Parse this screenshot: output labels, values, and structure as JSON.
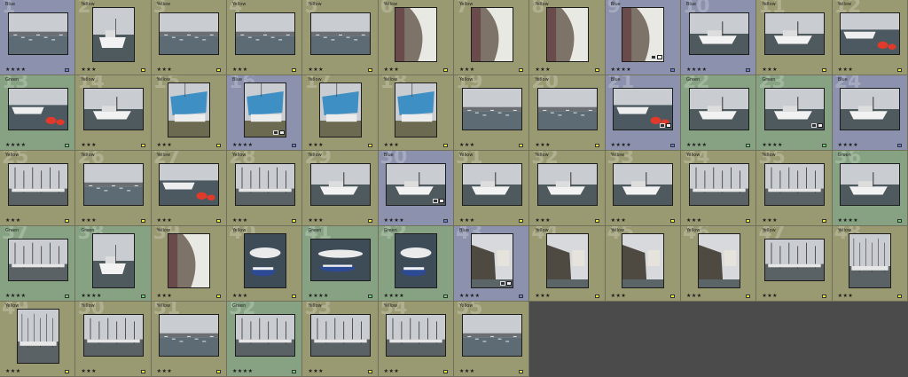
{
  "cells": [
    {
      "number": "1",
      "label": "Blue",
      "color": "Blue",
      "rating": "★★★★",
      "theme": "harbour"
    },
    {
      "number": "2",
      "label": "Yellow",
      "color": "Yellow",
      "rating": "★★★",
      "theme": "boats"
    },
    {
      "number": "3",
      "label": "Yellow",
      "color": "Yellow",
      "rating": "★★★",
      "theme": "harbour"
    },
    {
      "number": "4",
      "label": "Yellow",
      "color": "Yellow",
      "rating": "★★★",
      "theme": "harbour"
    },
    {
      "number": "5",
      "label": "Yellow",
      "color": "Yellow",
      "rating": "★★★",
      "theme": "harbour"
    },
    {
      "number": "6",
      "label": "Yellow",
      "color": "Yellow",
      "rating": "★★★",
      "theme": "hull"
    },
    {
      "number": "7",
      "label": "Yellow",
      "color": "Yellow",
      "rating": "★★★",
      "theme": "hull"
    },
    {
      "number": "8",
      "label": "Yellow",
      "color": "Yellow",
      "rating": "★★★",
      "theme": "hull"
    },
    {
      "number": "9",
      "label": "Blue",
      "color": "Blue",
      "rating": "★★★★",
      "theme": "hull",
      "badges": true
    },
    {
      "number": "10",
      "label": "Blue",
      "color": "Blue",
      "rating": "★★★★",
      "theme": "boats"
    },
    {
      "number": "11",
      "label": "Yellow",
      "color": "Yellow",
      "rating": "★★★",
      "theme": "boats"
    },
    {
      "number": "12",
      "label": "Yellow",
      "color": "Yellow",
      "rating": "★★★",
      "theme": "buoys"
    },
    {
      "number": "13",
      "label": "Green",
      "color": "Green",
      "rating": "★★★★",
      "theme": "buoys"
    },
    {
      "number": "14",
      "label": "Yellow",
      "color": "Yellow",
      "rating": "★★★",
      "theme": "boats"
    },
    {
      "number": "15",
      "label": "Yellow",
      "color": "Yellow",
      "rating": "★★★",
      "theme": "blue"
    },
    {
      "number": "16",
      "label": "Blue",
      "color": "Blue",
      "rating": "★★★★",
      "theme": "blue",
      "badges": true
    },
    {
      "number": "17",
      "label": "Yellow",
      "color": "Yellow",
      "rating": "★★★",
      "theme": "blue"
    },
    {
      "number": "18",
      "label": "Yellow",
      "color": "Yellow",
      "rating": "★★★",
      "theme": "blue"
    },
    {
      "number": "19",
      "label": "Yellow",
      "color": "Yellow",
      "rating": "★★★",
      "theme": "harbour"
    },
    {
      "number": "20",
      "label": "Yellow",
      "color": "Yellow",
      "rating": "★★★",
      "theme": "harbour"
    },
    {
      "number": "21",
      "label": "Blue",
      "color": "Blue",
      "rating": "★★★★",
      "theme": "buoys",
      "badges": true
    },
    {
      "number": "22",
      "label": "Green",
      "color": "Green",
      "rating": "★★★★",
      "theme": "boats"
    },
    {
      "number": "23",
      "label": "Green",
      "color": "Green",
      "rating": "★★★★",
      "theme": "boats",
      "badges": true
    },
    {
      "number": "24",
      "label": "Blue",
      "color": "Blue",
      "rating": "★★★★",
      "theme": "boats"
    },
    {
      "number": "25",
      "label": "Yellow",
      "color": "Yellow",
      "rating": "★★★",
      "theme": "masts"
    },
    {
      "number": "26",
      "label": "Yellow",
      "color": "Yellow",
      "rating": "★★★",
      "theme": "harbour"
    },
    {
      "number": "27",
      "label": "Yellow",
      "color": "Yellow",
      "rating": "★★★",
      "theme": "buoys"
    },
    {
      "number": "28",
      "label": "Yellow",
      "color": "Yellow",
      "rating": "★★★",
      "theme": "masts"
    },
    {
      "number": "29",
      "label": "Yellow",
      "color": "Yellow",
      "rating": "★★★",
      "theme": "boats"
    },
    {
      "number": "30",
      "label": "Blue",
      "color": "Blue",
      "rating": "★★★★",
      "theme": "boats",
      "badges": true
    },
    {
      "number": "31",
      "label": "Yellow",
      "color": "Yellow",
      "rating": "★★★",
      "theme": "boats"
    },
    {
      "number": "32",
      "label": "Yellow",
      "color": "Yellow",
      "rating": "★★★",
      "theme": "boats"
    },
    {
      "number": "33",
      "label": "Yellow",
      "color": "Yellow",
      "rating": "★★★",
      "theme": "boats"
    },
    {
      "number": "34",
      "label": "Yellow",
      "color": "Yellow",
      "rating": "★★★",
      "theme": "masts"
    },
    {
      "number": "35",
      "label": "Yellow",
      "color": "Yellow",
      "rating": "★★★",
      "theme": "masts"
    },
    {
      "number": "36",
      "label": "Green",
      "color": "Green",
      "rating": "★★★★",
      "theme": "boats"
    },
    {
      "number": "37",
      "label": "Green",
      "color": "Green",
      "rating": "★★★★",
      "theme": "masts"
    },
    {
      "number": "38",
      "label": "Green",
      "color": "Green",
      "rating": "★★★★",
      "theme": "boats"
    },
    {
      "number": "39",
      "label": "Yellow",
      "color": "Yellow",
      "rating": "★★★",
      "theme": "hull"
    },
    {
      "number": "40",
      "label": "Yellow",
      "color": "Yellow",
      "rating": "★★★",
      "theme": "dinghy"
    },
    {
      "number": "41",
      "label": "Green",
      "color": "Green",
      "rating": "★★★★",
      "theme": "dinghy"
    },
    {
      "number": "42",
      "label": "Green",
      "color": "Green",
      "rating": "★★★★",
      "theme": "dinghy"
    },
    {
      "number": "43",
      "label": "Blue",
      "color": "Blue",
      "rating": "★★★★",
      "theme": "wall",
      "badges": true
    },
    {
      "number": "44",
      "label": "Yellow",
      "color": "Yellow",
      "rating": "★★★",
      "theme": "wall"
    },
    {
      "number": "45",
      "label": "Yellow",
      "color": "Yellow",
      "rating": "★★★",
      "theme": "wall"
    },
    {
      "number": "46",
      "label": "Yellow",
      "color": "Yellow",
      "rating": "★★★",
      "theme": "wall"
    },
    {
      "number": "47",
      "label": "Yellow",
      "color": "Yellow",
      "rating": "★★★",
      "theme": "masts"
    },
    {
      "number": "48",
      "label": "Yellow",
      "color": "Yellow",
      "rating": "★★★",
      "theme": "masts"
    },
    {
      "number": "49",
      "label": "Yellow",
      "color": "Yellow",
      "rating": "★★★",
      "theme": "masts"
    },
    {
      "number": "50",
      "label": "Yellow",
      "color": "Yellow",
      "rating": "★★★",
      "theme": "masts"
    },
    {
      "number": "51",
      "label": "Yellow",
      "color": "Yellow",
      "rating": "★★★",
      "theme": "harbour"
    },
    {
      "number": "52",
      "label": "Green",
      "color": "Green",
      "rating": "★★★★",
      "theme": "masts"
    },
    {
      "number": "53",
      "label": "Yellow",
      "color": "Yellow",
      "rating": "★★★",
      "theme": "masts"
    },
    {
      "number": "54",
      "label": "Yellow",
      "color": "Yellow",
      "rating": "★★★",
      "theme": "masts"
    },
    {
      "number": "55",
      "label": "Yellow",
      "color": "Yellow",
      "rating": "★★★",
      "theme": "harbour"
    }
  ],
  "colors": {
    "Yellow": "#9a9a72",
    "Blue": "#8c92ad",
    "Green": "#86a282",
    "empty": "#4b4b4b",
    "flag_yellow": "#eded3a",
    "flag_blue": "#6a7fd6",
    "flag_green": "#6fd06f"
  },
  "icons": {
    "flag": "color-label-flag",
    "badges": "edit-badge-icon"
  }
}
